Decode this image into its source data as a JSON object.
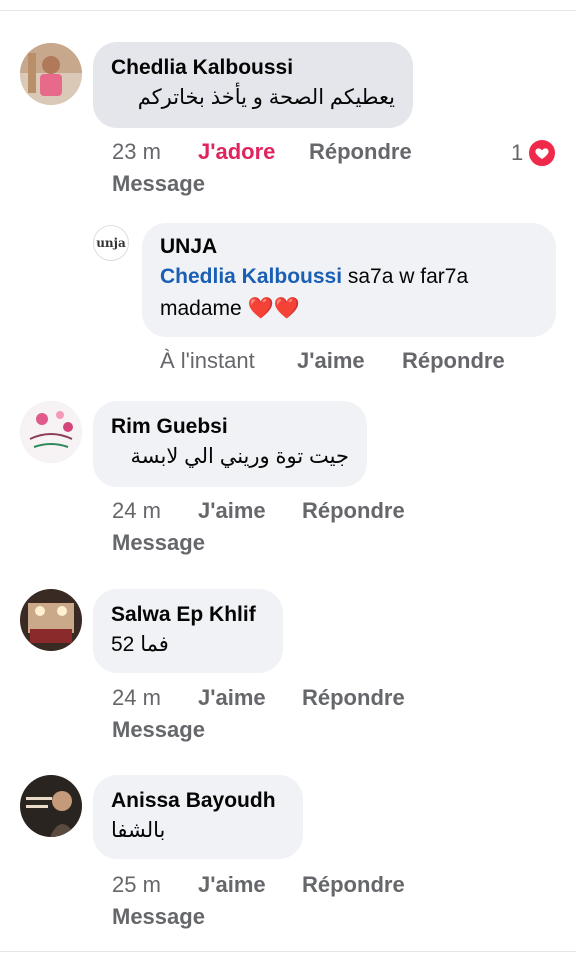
{
  "comments": [
    {
      "author": "Chedlia Kalboussi",
      "text": "يعطيكم الصحة و يأخذ بخاتركم",
      "time": "23 m",
      "like_label": "J'adore",
      "reply_label": "Répondre",
      "message_label": "Message",
      "reaction_count": "1"
    },
    {
      "author": "UNJA",
      "avatar_text": "unja",
      "mention": "Chedlia Kalboussi",
      "text": " sa7a w far7a madame ❤️❤️",
      "time": "À l'instant",
      "like_label": "J'aime",
      "reply_label": "Répondre"
    },
    {
      "author": "Rim Guebsi",
      "text": "جيت توة وريني الي لابسة",
      "time": "24 m",
      "like_label": "J'aime",
      "reply_label": "Répondre",
      "message_label": "Message"
    },
    {
      "author": "Salwa Ep Khlif",
      "text": "فما 52",
      "time": "24 m",
      "like_label": "J'aime",
      "reply_label": "Répondre",
      "message_label": "Message"
    },
    {
      "author": "Anissa Bayoudh",
      "text": "بالشفا",
      "time": "25 m",
      "like_label": "J'aime",
      "reply_label": "Répondre",
      "message_label": "Message"
    }
  ],
  "colors": {
    "accent_link": "#1a5fb4",
    "adore": "#e0245e",
    "meta": "#65676b",
    "bubble": "#e4e6eb"
  }
}
